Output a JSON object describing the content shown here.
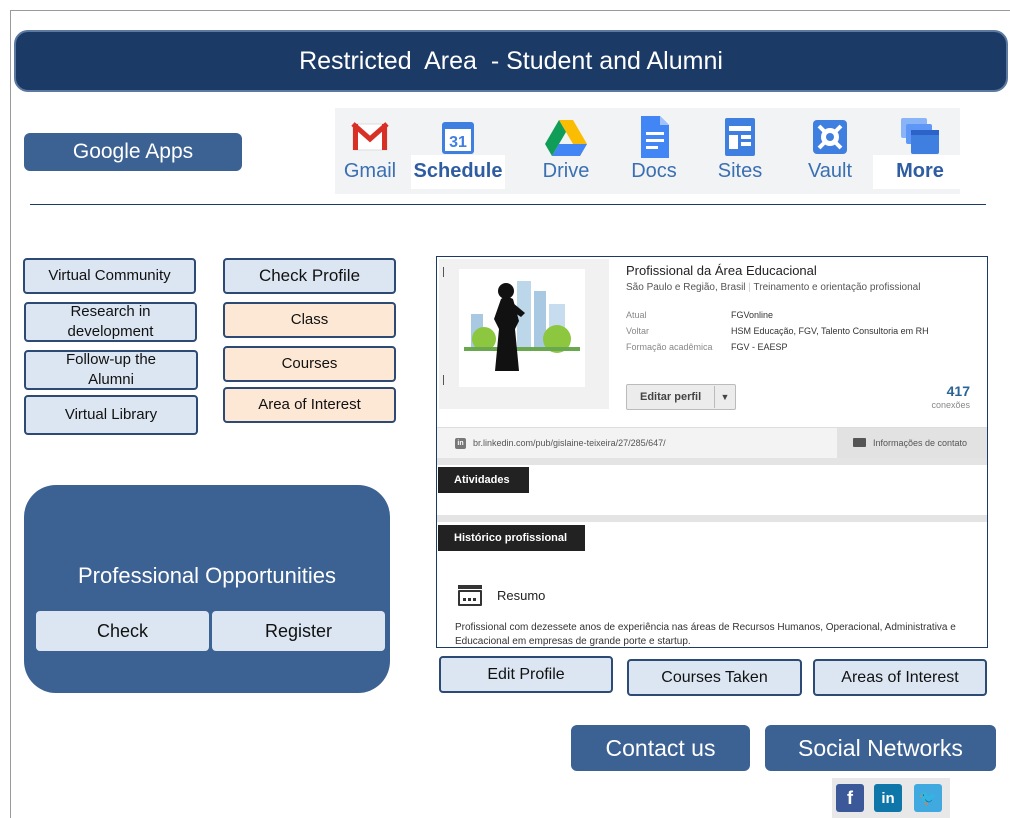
{
  "header": {
    "title": "Restricted  Area  - Student and Alumni"
  },
  "google_apps": {
    "label": "Google Apps",
    "apps": [
      {
        "label": "Gmail",
        "icon": "gmail-icon"
      },
      {
        "label": "Schedule",
        "icon": "calendar-icon",
        "calendar_day": "31"
      },
      {
        "label": "Drive",
        "icon": "drive-icon"
      },
      {
        "label": "Docs",
        "icon": "docs-icon"
      },
      {
        "label": "Sites",
        "icon": "sites-icon"
      },
      {
        "label": "Vault",
        "icon": "vault-icon"
      },
      {
        "label": "More",
        "icon": "more-icon"
      }
    ]
  },
  "menu": {
    "left": [
      "Virtual Community",
      "Research in development",
      "Follow-up the Alumni",
      "Virtual Library"
    ],
    "right": [
      "Check Profile",
      "Class",
      "Courses",
      "Area of Interest"
    ]
  },
  "opportunities": {
    "title": "Professional Opportunities",
    "check": "Check",
    "register": "Register"
  },
  "profile": {
    "headline": "Profissional da Área Educacional",
    "location": "São Paulo e Região, Brasil",
    "industry": "Treinamento e orientação profissional",
    "details": [
      {
        "key": "Atual",
        "value": "FGVonline"
      },
      {
        "key": "Voltar",
        "value": "HSM Educação, FGV, Talento Consultoria em RH"
      },
      {
        "key": "Formação acadêmica",
        "value": "FGV - EAESP"
      }
    ],
    "edit_button": "Editar perfil",
    "connections_count": "417",
    "connections_label": "conexões",
    "url_icon_text": "in",
    "url": "br.linkedin.com/pub/gislaine-teixeira/27/285/647/",
    "contact_info": "Informações de contato",
    "activities_tab": "Atividades",
    "history_tab": "Histórico profissional",
    "summary_title": "Resumo",
    "summary_text": "Profissional com dezessete anos de experiência nas áreas de Recursos Humanos, Operacional, Administrativa e Educacional em empresas de grande porte e startup."
  },
  "profile_actions": {
    "edit_profile": "Edit Profile",
    "courses_taken": "Courses Taken",
    "areas_of_interest": "Areas of Interest"
  },
  "footer": {
    "contact_us": "Contact us",
    "social_networks": "Social Networks"
  },
  "social": [
    {
      "icon": "facebook-icon",
      "glyph": "f",
      "color": "#3b5998"
    },
    {
      "icon": "linkedin-icon",
      "glyph": "in",
      "color": "#0e76a8"
    },
    {
      "icon": "twitter-icon",
      "glyph": "🐦",
      "color": "#3fa9e0"
    }
  ]
}
